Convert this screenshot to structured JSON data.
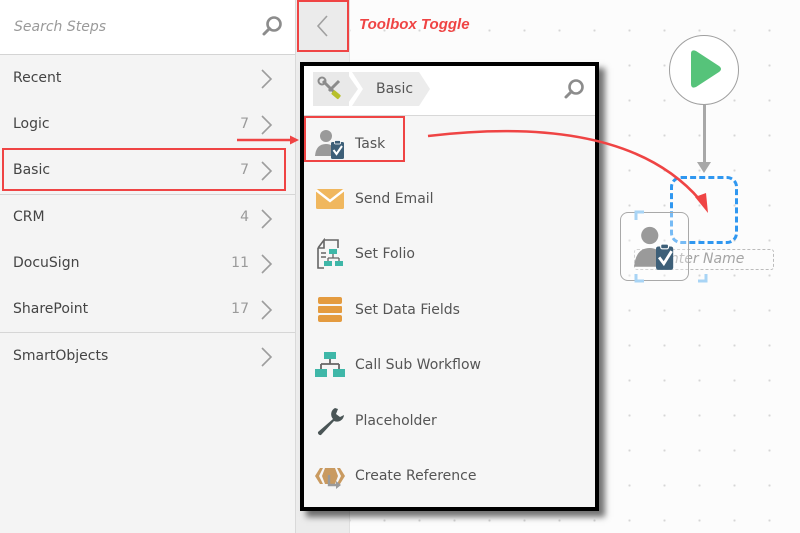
{
  "sidebar": {
    "search": {
      "placeholder": "Search Steps",
      "value": "",
      "icon": "search-icon"
    },
    "categories": [
      {
        "label": "Recent",
        "count": ""
      },
      {
        "label": "Logic",
        "count": "7"
      },
      {
        "label": "Basic",
        "count": "7",
        "highlighted": true
      },
      {
        "label": "CRM",
        "count": "4"
      },
      {
        "label": "DocuSign",
        "count": "11"
      },
      {
        "label": "SharePoint",
        "count": "17"
      },
      {
        "label": "SmartObjects",
        "count": ""
      }
    ]
  },
  "toolbox_toggle": {
    "icon": "chevron-left-icon",
    "annotation": "Toolbox Toggle"
  },
  "toolbox_panel": {
    "breadcrumb": {
      "root_icon": "tools-icon",
      "current": "Basic"
    },
    "search_icon": "search-icon",
    "steps": [
      {
        "label": "Task",
        "icon": "task-icon",
        "highlighted": true
      },
      {
        "label": "Send Email",
        "icon": "email-icon"
      },
      {
        "label": "Set Folio",
        "icon": "set-folio-icon"
      },
      {
        "label": "Set Data Fields",
        "icon": "data-fields-icon"
      },
      {
        "label": "Call Sub Workflow",
        "icon": "sub-workflow-icon"
      },
      {
        "label": "Placeholder",
        "icon": "wrench-icon"
      },
      {
        "label": "Create Reference",
        "icon": "create-reference-icon"
      }
    ]
  },
  "canvas": {
    "start_node_icon": "play-icon",
    "new_step_name_placeholder": "Enter Name"
  },
  "colors": {
    "annotation_red": "#ef4444",
    "play_green": "#56c37a",
    "drop_blue": "#2f97f0",
    "teal": "#3fb7a8",
    "orange": "#e49b3f",
    "task_blue": "#3d5f78"
  }
}
